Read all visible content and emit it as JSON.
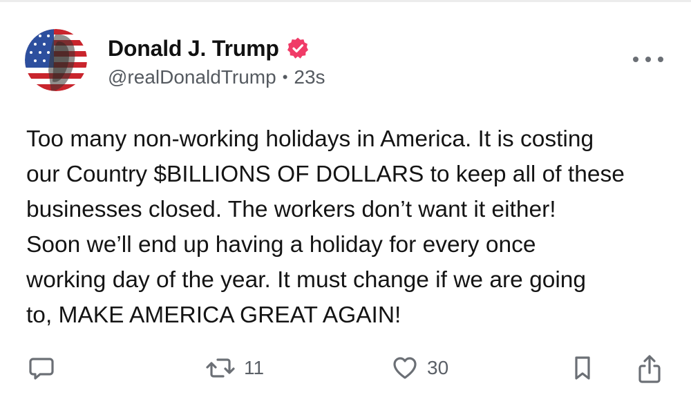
{
  "author": {
    "display_name": "Donald J. Trump",
    "handle": "@realDonaldTrump",
    "timestamp": "23s",
    "verified": true
  },
  "post": {
    "text": "Too many non-working holidays in America. It is costing\nour Country $BILLIONS OF DOLLARS to keep all of these\nbusinesses closed. The workers don’t want it either!\nSoon we’ll end up having a holiday for every once\nworking day of the year. It must change if we are going\nto, MAKE AMERICA GREAT AGAIN!"
  },
  "actions": {
    "reply_icon": "comment-icon",
    "repost_icon": "repost-icon",
    "repost_count": "11",
    "like_icon": "heart-icon",
    "like_count": "30",
    "bookmark_icon": "bookmark-icon",
    "share_icon": "share-icon"
  },
  "colors": {
    "verified_badge": "#f03b67",
    "icon_gray": "#6b6f75",
    "text_secondary": "#555a60"
  }
}
